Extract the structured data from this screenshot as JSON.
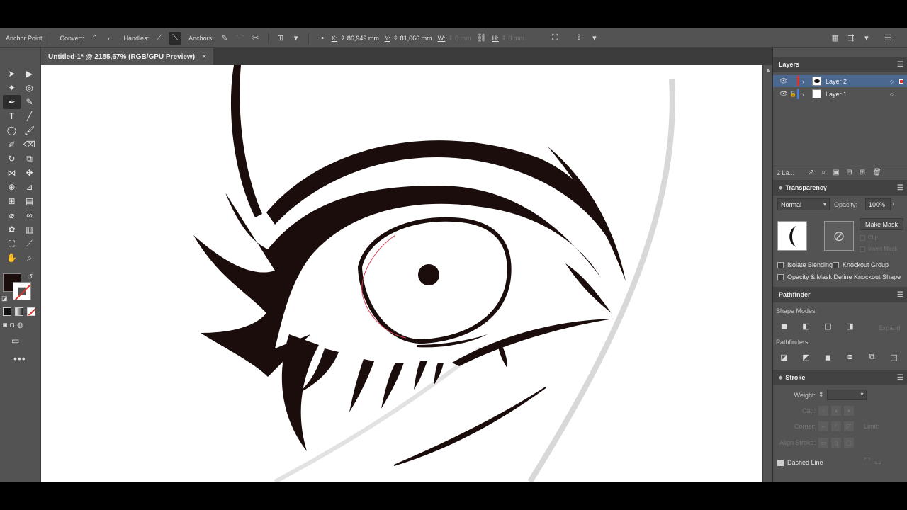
{
  "control_bar": {
    "mode_label": "Anchor Point",
    "convert_label": "Convert:",
    "handles_label": "Handles:",
    "anchors_label": "Anchors:",
    "x_label": "X:",
    "x_value": "86,949 mm",
    "y_label": "Y:",
    "y_value": "81,066 mm",
    "w_label": "W:",
    "w_value": "0 mm",
    "h_label": "H:",
    "h_value": "0 mm"
  },
  "document": {
    "tab_title": "Untitled-1* @ 2185,67% (RGB/GPU Preview)",
    "close_glyph": "×"
  },
  "colors": {
    "fill": "#1a0d0b",
    "stroke": "none",
    "accent_selection": "#4b6890"
  },
  "layers_panel": {
    "title": "Layers",
    "layers": [
      {
        "name": "Layer 2",
        "color": "#e0302a",
        "selected": true,
        "locked": false
      },
      {
        "name": "Layer 1",
        "color": "#4a7fd6",
        "selected": false,
        "locked": true
      }
    ],
    "count": "2 La..."
  },
  "transparency_panel": {
    "title": "Transparency",
    "blend_mode": "Normal",
    "opacity_label": "Opacity:",
    "opacity_value": "100%",
    "make_mask_label": "Make Mask",
    "clip_label": "Clip",
    "invert_mask_label": "Invert Mask",
    "isolate_blending": "Isolate Blending",
    "knockout_group": "Knockout Group",
    "opacity_mask_define": "Opacity & Mask Define Knockout Shape"
  },
  "pathfinder_panel": {
    "title": "Pathfinder",
    "shape_modes_label": "Shape Modes:",
    "expand_label": "Expand",
    "pathfinders_label": "Pathfinders:"
  },
  "stroke_panel": {
    "title": "Stroke",
    "weight_label": "Weight:",
    "cap_label": "Cap:",
    "corner_label": "Corner:",
    "limit_label": "Limit:",
    "align_label": "Align Stroke:",
    "dashed_line_label": "Dashed Line"
  }
}
